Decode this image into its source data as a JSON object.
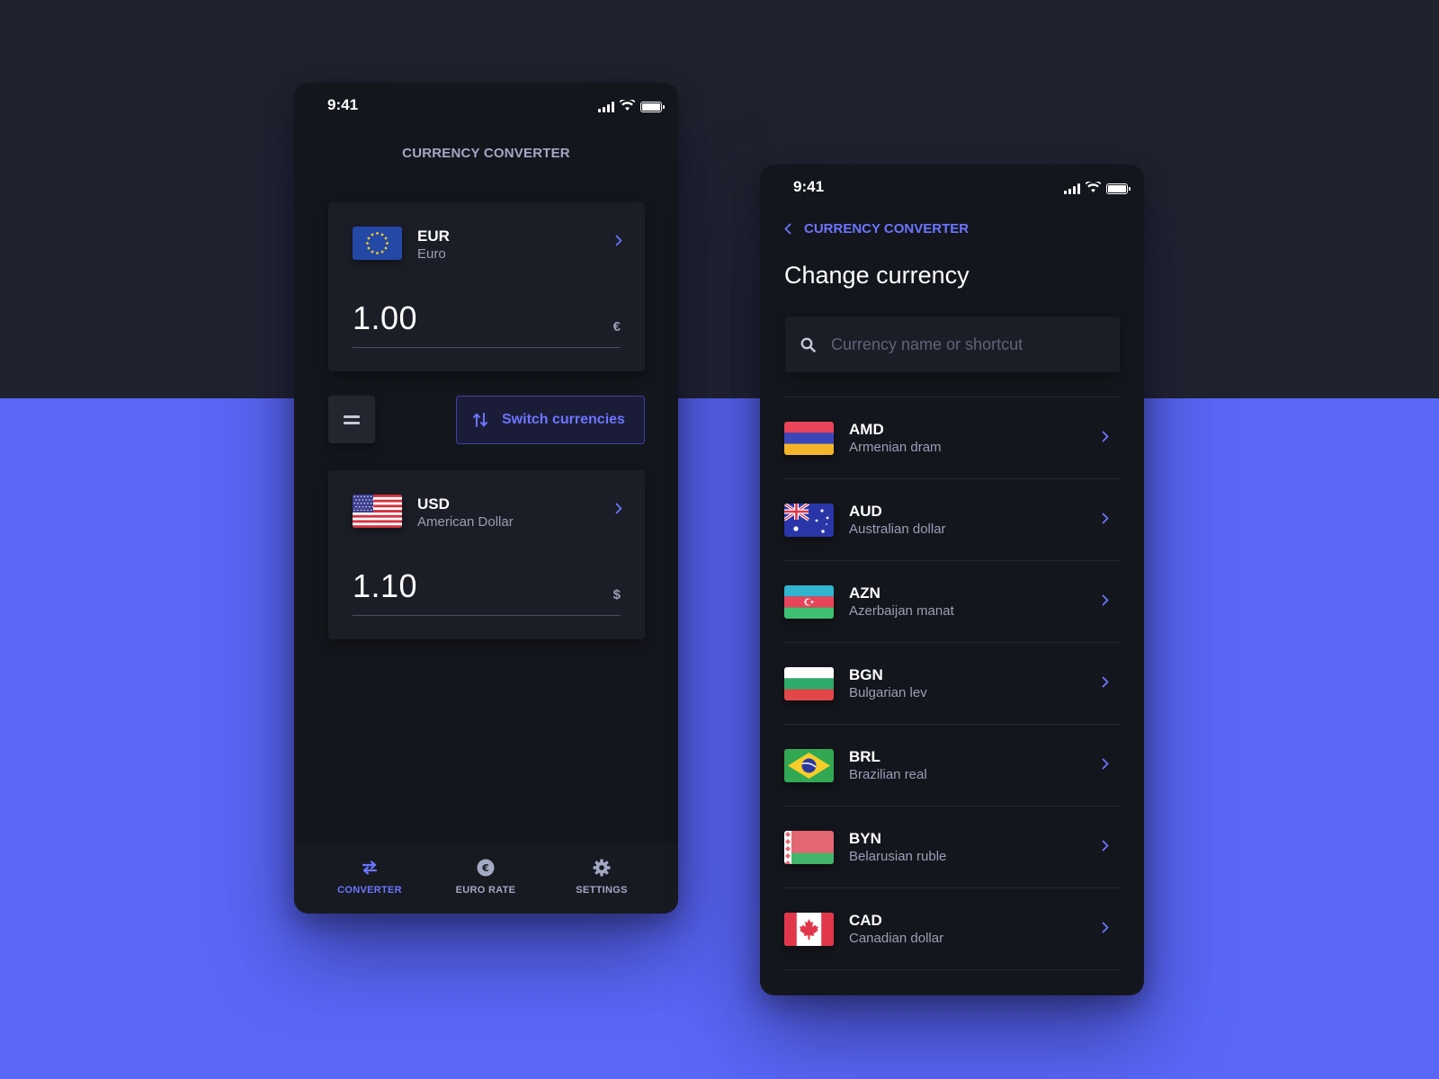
{
  "colors": {
    "accent": "#6b76ff",
    "background_top": "#20232e",
    "background_bottom": "#5a67f8",
    "panel": "#14161d",
    "card": "#1c1e27"
  },
  "converter": {
    "status_time": "9:41",
    "title": "CURRENCY CONVERTER",
    "from": {
      "code": "EUR",
      "name": "Euro",
      "amount": "1.00",
      "symbol": "€",
      "flag": "eu-flag"
    },
    "equals_icon": "equals-icon",
    "switch_label": "Switch currencies",
    "to": {
      "code": "USD",
      "name": "American Dollar",
      "amount": "1.10",
      "symbol": "$",
      "flag": "us-flag"
    },
    "tabs": [
      {
        "label": "CONVERTER",
        "icon": "swap-arrows-icon",
        "active": true
      },
      {
        "label": "EURO RATE",
        "icon": "euro-coin-icon",
        "active": false
      },
      {
        "label": "SETTINGS",
        "icon": "gear-icon",
        "active": false
      }
    ]
  },
  "picker": {
    "status_time": "9:41",
    "back_label": "CURRENCY CONVERTER",
    "heading": "Change currency",
    "search_placeholder": "Currency name or shortcut",
    "currencies": [
      {
        "code": "AMD",
        "name": "Armenian dram",
        "flag": "armenia-flag"
      },
      {
        "code": "AUD",
        "name": "Australian dollar",
        "flag": "australia-flag"
      },
      {
        "code": "AZN",
        "name": "Azerbaijan manat",
        "flag": "azerbaijan-flag"
      },
      {
        "code": "BGN",
        "name": "Bulgarian lev",
        "flag": "bulgaria-flag"
      },
      {
        "code": "BRL",
        "name": "Brazilian real",
        "flag": "brazil-flag"
      },
      {
        "code": "BYN",
        "name": "Belarusian ruble",
        "flag": "belarus-flag"
      },
      {
        "code": "CAD",
        "name": "Canadian dollar",
        "flag": "canada-flag"
      }
    ]
  }
}
